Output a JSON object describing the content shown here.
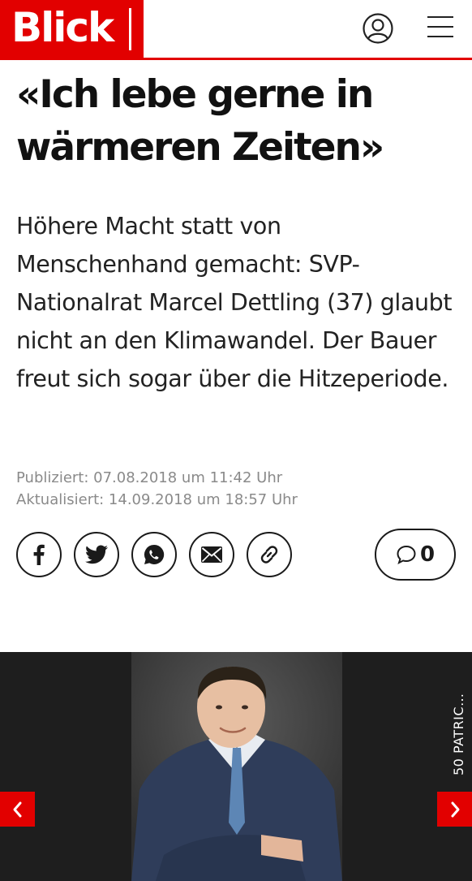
{
  "brand": {
    "name": "Blick",
    "color": "#e20000"
  },
  "header": {
    "user_icon": "user-circle-icon",
    "menu_icon": "hamburger-menu-icon"
  },
  "article": {
    "headline": "«Ich lebe gerne in wärmeren Zeiten»",
    "lead": "Höhere Macht statt von Menschenhand gemacht: SVP-Nationalrat Marcel Dettling (37) glaubt nicht an den Klimawandel. Der Bauer freut sich sogar über die Hitzeperiode.",
    "published": "Publiziert: 07.08.2018 um 11:42 Uhr",
    "updated": "Aktualisiert: 14.09.2018 um 18:57 Uhr"
  },
  "share": {
    "buttons": [
      {
        "name": "facebook",
        "icon": "facebook-icon"
      },
      {
        "name": "twitter",
        "icon": "twitter-icon"
      },
      {
        "name": "whatsapp",
        "icon": "whatsapp-icon"
      },
      {
        "name": "email",
        "icon": "mail-icon"
      },
      {
        "name": "link",
        "icon": "link-icon"
      }
    ],
    "comments_count": "0"
  },
  "gallery": {
    "caption": "50 PATRIC…",
    "prev_icon": "chevron-left-icon",
    "next_icon": "chevron-right-icon"
  }
}
